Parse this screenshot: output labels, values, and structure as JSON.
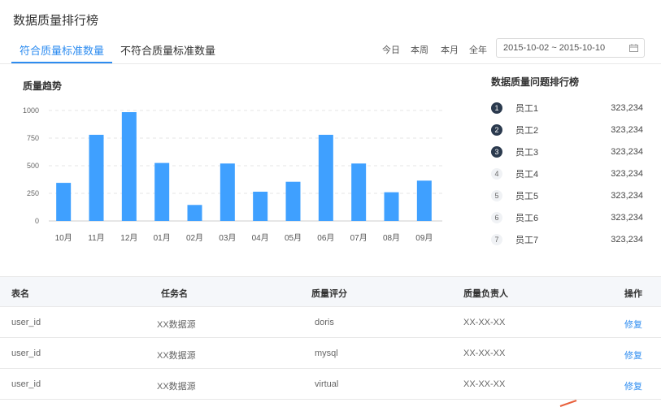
{
  "page": {
    "title": "数据质量排行榜"
  },
  "tabs": [
    {
      "label": "符合质量标准数量",
      "active": true
    },
    {
      "label": "不符合质量标准数量",
      "active": false
    }
  ],
  "range": {
    "links": [
      "今日",
      "本周",
      "本月",
      "全年"
    ],
    "date_value": "2015-10-02 ~ 2015-10-10",
    "calendar_icon": "calendar-icon"
  },
  "chart_data": {
    "type": "bar",
    "title": "质量趋势",
    "categories": [
      "10月",
      "11月",
      "12月",
      "01月",
      "02月",
      "03月",
      "04月",
      "05月",
      "06月",
      "07月",
      "08月",
      "09月"
    ],
    "values": [
      345,
      780,
      985,
      525,
      145,
      520,
      265,
      355,
      780,
      520,
      260,
      365
    ],
    "ylim": [
      0,
      1000
    ],
    "yticks": [
      0,
      250,
      500,
      750,
      1000
    ],
    "grid": true,
    "color": "#3fa0ff"
  },
  "ranking": {
    "title": "数据质量问题排行榜",
    "items": [
      {
        "rank": "1",
        "name": "员工1",
        "value": "323,234"
      },
      {
        "rank": "2",
        "name": "员工2",
        "value": "323,234"
      },
      {
        "rank": "3",
        "name": "员工3",
        "value": "323,234"
      },
      {
        "rank": "4",
        "name": "员工4",
        "value": "323,234"
      },
      {
        "rank": "5",
        "name": "员工5",
        "value": "323,234"
      },
      {
        "rank": "6",
        "name": "员工6",
        "value": "323,234"
      },
      {
        "rank": "7",
        "name": "员工7",
        "value": "323,234"
      }
    ]
  },
  "table": {
    "headers": [
      "表名",
      "任务名",
      "质量评分",
      "质量负责人",
      "操作"
    ],
    "rows": [
      [
        "user_id",
        "XX数据源",
        "doris",
        "XX-XX-XX",
        "修复"
      ],
      [
        "user_id",
        "XX数据源",
        "mysql",
        "XX-XX-XX",
        "修复"
      ],
      [
        "user_id",
        "XX数据源",
        "virtual",
        "XX-XX-XX",
        "修复"
      ]
    ]
  }
}
